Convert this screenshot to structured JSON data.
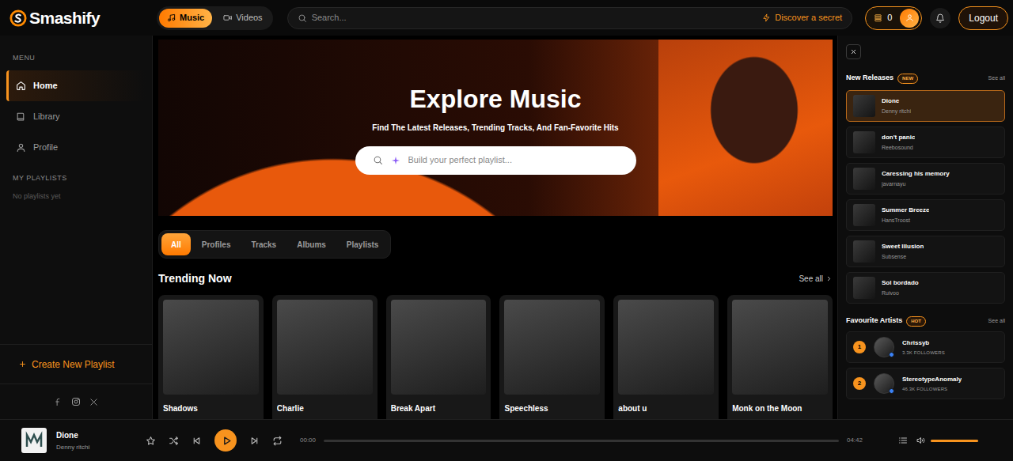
{
  "brand": {
    "name": "Smashify"
  },
  "media_tabs": [
    {
      "label": "Music",
      "selected": true
    },
    {
      "label": "Videos",
      "selected": false
    }
  ],
  "search": {
    "placeholder": "Search...",
    "secret": "Discover a secret"
  },
  "account": {
    "coins": "0",
    "logout": "Logout"
  },
  "sidebar": {
    "menu_title": "MENU",
    "items": [
      {
        "label": "Home",
        "selected": true
      },
      {
        "label": "Library",
        "selected": false
      },
      {
        "label": "Profile",
        "selected": false
      }
    ],
    "playlists_title": "MY PLAYLISTS",
    "playlists_empty": "No playlists yet",
    "create": "Create New Playlist"
  },
  "hero": {
    "title": "Explore Music",
    "subtitle": "Find The Latest Releases, Trending Tracks, And Fan-Favorite Hits",
    "placeholder": "Build your perfect playlist..."
  },
  "filters": [
    {
      "label": "All",
      "selected": true
    },
    {
      "label": "Profiles",
      "selected": false
    },
    {
      "label": "Tracks",
      "selected": false
    },
    {
      "label": "Albums",
      "selected": false
    },
    {
      "label": "Playlists",
      "selected": false
    }
  ],
  "trending": {
    "title": "Trending Now",
    "see_all": "See all",
    "cards": [
      {
        "title": "Shadows"
      },
      {
        "title": "Charlie"
      },
      {
        "title": "Break Apart"
      },
      {
        "title": "Speechless"
      },
      {
        "title": "about u"
      },
      {
        "title": "Monk on the Moon"
      }
    ]
  },
  "new_releases": {
    "title": "New Releases",
    "badge": "NEW",
    "see_all": "See all",
    "items": [
      {
        "title": "Dione",
        "artist": "Denny ritchi",
        "selected": true
      },
      {
        "title": "don't panic",
        "artist": "Reebosound",
        "selected": false
      },
      {
        "title": "Caressing his memory",
        "artist": "javarnayu",
        "selected": false
      },
      {
        "title": "Summer Breeze",
        "artist": "HansTroost",
        "selected": false
      },
      {
        "title": "Sweet Illusion",
        "artist": "Subsense",
        "selected": false
      },
      {
        "title": "Sol bordado",
        "artist": "Ruivoo",
        "selected": false
      }
    ]
  },
  "favourite_artists": {
    "title": "Favourite Artists",
    "badge": "HOT",
    "see_all": "See all",
    "items": [
      {
        "rank": "1",
        "name": "Chrissyb",
        "followers": "3.3K FOLLOWERS"
      },
      {
        "rank": "2",
        "name": "StereotypeAnomaly",
        "followers": "46.3K FOLLOWERS"
      }
    ]
  },
  "player": {
    "title": "Dione",
    "artist": "Denny ritchi",
    "elapsed": "00:00",
    "duration": "04:42",
    "progress": 0,
    "volume": 1
  }
}
